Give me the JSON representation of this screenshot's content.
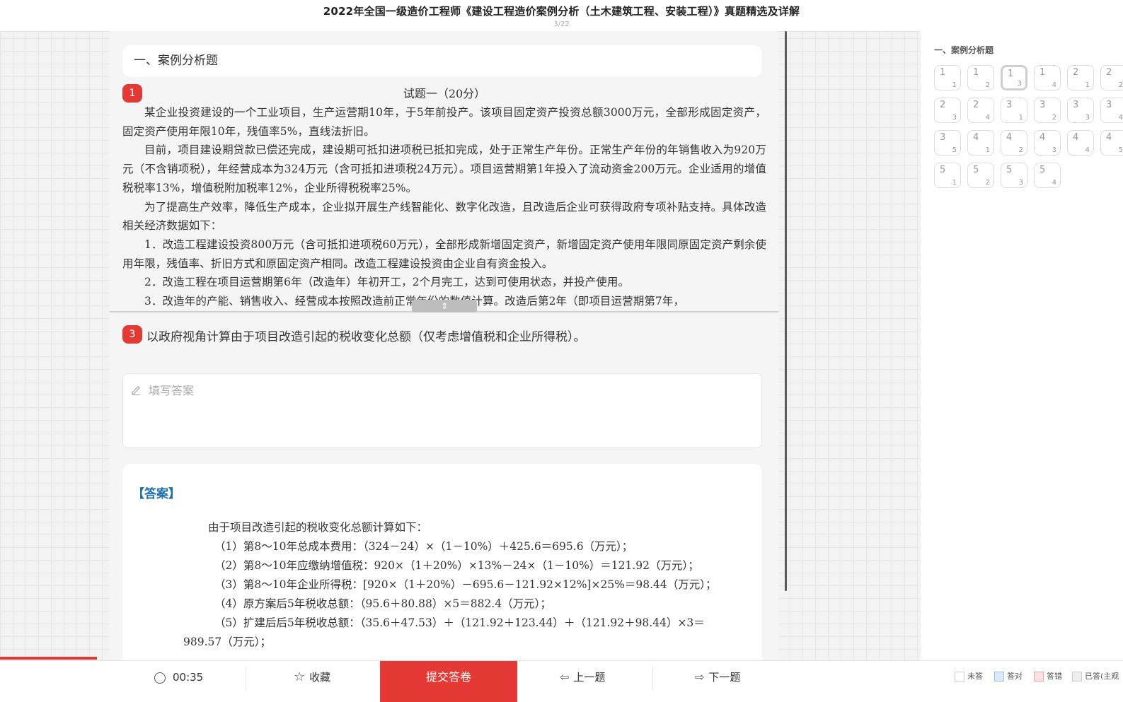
{
  "header": {
    "title": "2022年全国一级造价工程师《建设工程造价案例分析（土木建筑工程、安装工程）》真题精选及详解",
    "page_indicator": "3/22"
  },
  "section": {
    "title": "一、案例分析题"
  },
  "question": {
    "number": "1",
    "heading": "试题一（20分）",
    "paragraphs": [
      "某企业投资建设的一个工业项目，生产运营期10年，于5年前投产。该项目固定资产投资总额3000万元，全部形成固定资产，固定资产使用年限10年，残值率5%，直线法折旧。",
      "目前，项目建设期贷款已偿还完成，建设期可抵扣进项税已抵扣完成，处于正常生产年份。正常生产年份的年销售收入为920万元（不含销项税），年经营成本为324万元（含可抵扣进项税24万元）。项目运营期第1年投入了流动资金200万元。企业适用的增值税税率13%，增值税附加税率12%，企业所得税税率25%。",
      "为了提高生产效率，降低生产成本，企业拟开展生产线智能化、数字化改造，且改造后企业可获得政府专项补贴支持。具体改造相关经济数据如下：",
      "1．改造工程建设投资800万元（含可抵扣进项税60万元），全部形成新增固定资产，新增固定资产使用年限同原固定资产剩余使用年限，残值率、折旧方式和原固定资产相同。改造工程建设投资由企业自有资金投入。",
      "2．改造工程在项目运营期第6年（改造年）年初开工，2个月完工，达到可使用状态，并投产使用。",
      "3．改造年的产能、销售收入、经营成本按照改造前正常年份的数值计算。改造后第2年（即项目运营期第7年，"
    ]
  },
  "subquestion": {
    "number": "3",
    "text": "以政府视角计算由于项目改造引起的税收变化总额（仅考虑增值税和企业所得税）。"
  },
  "answer_input": {
    "placeholder": "填写答案"
  },
  "answer": {
    "tag": "【答案】",
    "lines": [
      "由于项目改造引起的税收变化总额计算如下：",
      "（1）第8～10年总成本费用：（324－24）×（1－10%）＋425.6＝695.6（万元）；",
      "（2）第8～10年应缴纳增值税：920×（1＋20%）×13%－24×（1－10%）＝121.92（万元）；",
      "（3）第8～10年企业所得税：[920×（1＋20%）－695.6－121.92×12%]×25%＝98.44（万元）；",
      "（4）原方案后5年税收总额：（95.6＋80.88）×5＝882.4（万元）；",
      "（5）扩建后后5年税收总额：（35.6＋47.53）＋（121.92＋123.44）＋（121.92＋98.44）×3＝",
      "989.57（万元）；"
    ]
  },
  "right_panel": {
    "title": "一、案例分析题",
    "items": [
      {
        "main": "1",
        "sub": "1"
      },
      {
        "main": "1",
        "sub": "2"
      },
      {
        "main": "1",
        "sub": "3",
        "current": true
      },
      {
        "main": "1",
        "sub": "4"
      },
      {
        "main": "2",
        "sub": "1"
      },
      {
        "main": "2",
        "sub": "2"
      },
      {
        "main": "2",
        "sub": "3"
      },
      {
        "main": "2",
        "sub": "4"
      },
      {
        "main": "3",
        "sub": "1"
      },
      {
        "main": "3",
        "sub": "2"
      },
      {
        "main": "3",
        "sub": "3"
      },
      {
        "main": "3",
        "sub": "4"
      },
      {
        "main": "3",
        "sub": "5"
      },
      {
        "main": "4",
        "sub": "1"
      },
      {
        "main": "4",
        "sub": "2"
      },
      {
        "main": "4",
        "sub": "3"
      },
      {
        "main": "4",
        "sub": "4"
      },
      {
        "main": "4",
        "sub": "5"
      },
      {
        "main": "5",
        "sub": "1"
      },
      {
        "main": "5",
        "sub": "2"
      },
      {
        "main": "5",
        "sub": "3"
      },
      {
        "main": "5",
        "sub": "4"
      }
    ]
  },
  "bottom": {
    "timer": "00:35",
    "favorite": "收藏",
    "submit": "提交答卷",
    "prev": "上一题",
    "next": "下一题"
  },
  "legend": [
    {
      "label": "未答",
      "color": "#ffffff"
    },
    {
      "label": "答对",
      "color": "#dbe9fb"
    },
    {
      "label": "答错",
      "color": "#fbe0e0"
    },
    {
      "label": "已答(主观",
      "color": "#eeeeee"
    }
  ],
  "colors": {
    "accent": "#e53935",
    "answer_tag": "#1d6fa5"
  }
}
